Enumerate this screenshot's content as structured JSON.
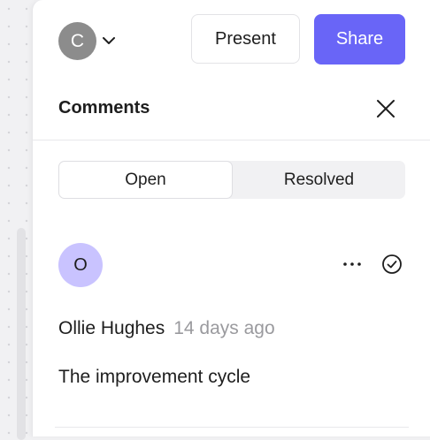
{
  "header": {
    "user_initial": "C",
    "present_label": "Present",
    "share_label": "Share",
    "share_color": "#6965f7"
  },
  "comments_panel": {
    "title": "Comments",
    "tabs": [
      {
        "label": "Open",
        "active": true
      },
      {
        "label": "Resolved",
        "active": false
      }
    ]
  },
  "comments": [
    {
      "avatar_initial": "O",
      "avatar_color": "#c9c3ff",
      "author": "Ollie Hughes",
      "time": "14 days ago",
      "text": "The improvement cycle"
    }
  ],
  "icons": [
    "chevron-down-icon",
    "close-icon",
    "more-icon",
    "resolve-check-icon"
  ]
}
